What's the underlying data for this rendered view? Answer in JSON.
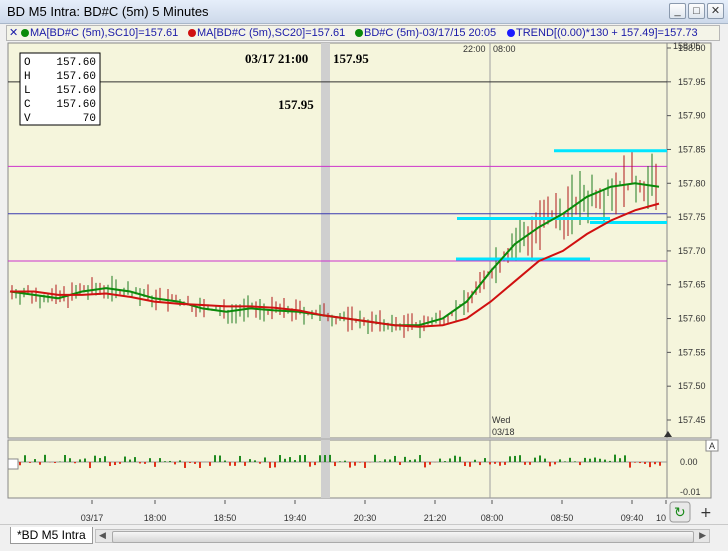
{
  "window": {
    "title": "BD M5 Intra: BD#C (5m) 5 Minutes"
  },
  "legend": [
    {
      "text": "MA[BD#C (5m),SC10]=157.61",
      "color": "#0a8a0a"
    },
    {
      "text": "MA[BD#C (5m),SC20]=157.61",
      "color": "#d01010"
    },
    {
      "text": "BD#C (5m)-03/17/15 20:05",
      "color": "#0a8a0a"
    },
    {
      "text": "TREND[(0.00)*130 + 157.49]=157.73",
      "color": "#1a1aff"
    }
  ],
  "ohlcv": {
    "labels": [
      "O",
      "H",
      "L",
      "C",
      "V"
    ],
    "values": [
      "157.60",
      "157.60",
      "157.60",
      "157.60",
      "70"
    ]
  },
  "cursor": {
    "datetime": "03/17 21:00",
    "price": "157.95",
    "price_flag": "157.95"
  },
  "session_labels": {
    "s1": "22:00",
    "s2": "08:00",
    "day": "Wed",
    "date": "03/18"
  },
  "x_ticks": [
    "03/17",
    "18:00",
    "18:50",
    "19:40",
    "20:30",
    "21:20",
    "08:00",
    "08:50",
    "09:40",
    "10"
  ],
  "y_ticks": [
    "158.00",
    "157.95",
    "157.90",
    "157.85",
    "157.80",
    "157.75",
    "157.70",
    "157.65",
    "157.60",
    "157.55",
    "157.50",
    "157.45"
  ],
  "osc_ticks": [
    "0.00",
    "-0.01"
  ],
  "osc_ceiling": "158.05",
  "tab": {
    "label": "*BD M5 Intra"
  },
  "colors": {
    "bg": "#f5f5dc",
    "ma_fast": "#0a8a0a",
    "ma_slow": "#d01010",
    "trend": "#00e5ff",
    "grid_h": "#cc33cc"
  },
  "chart_data": {
    "type": "line",
    "title": "BD#C (5m) 5 Minutes",
    "ylim": [
      157.44,
      158.05
    ],
    "horizontal_lines": [
      157.95,
      157.825,
      157.755,
      157.685
    ],
    "series": [
      {
        "name": "MA[BD#C (5m),SC10]",
        "values": [
          157.64,
          157.635,
          157.63,
          157.64,
          157.645,
          157.64,
          157.63,
          157.625,
          157.615,
          157.61,
          157.615,
          157.612,
          157.61,
          157.605,
          157.6,
          157.595,
          157.59,
          157.59,
          157.6,
          157.625,
          157.67,
          157.71,
          157.735,
          157.755,
          157.78,
          157.795,
          157.8,
          157.795
        ]
      },
      {
        "name": "MA[BD#C (5m),SC20]",
        "values": [
          157.64,
          157.64,
          157.635,
          157.635,
          157.637,
          157.632,
          157.625,
          157.622,
          157.62,
          157.618,
          157.618,
          157.616,
          157.612,
          157.605,
          157.6,
          157.595,
          157.59,
          157.588,
          157.59,
          157.6,
          157.625,
          157.655,
          157.685,
          157.7,
          157.725,
          157.745,
          157.76,
          157.77
        ]
      }
    ]
  }
}
